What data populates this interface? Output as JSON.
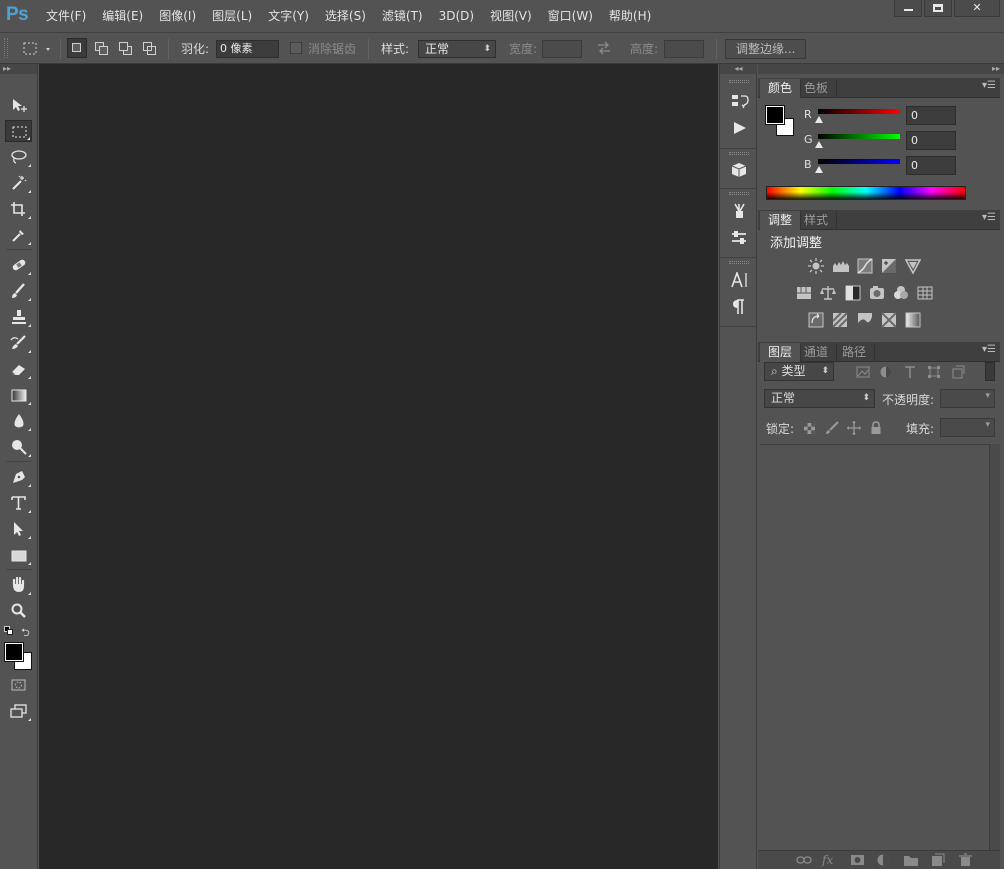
{
  "app": {
    "logo": "Ps",
    "menus": [
      "文件(F)",
      "编辑(E)",
      "图像(I)",
      "图层(L)",
      "文字(Y)",
      "选择(S)",
      "滤镜(T)",
      "3D(D)",
      "视图(V)",
      "窗口(W)",
      "帮助(H)"
    ],
    "window_close": "✕"
  },
  "options": {
    "feather_label": "羽化:",
    "feather_value": "0 像素",
    "antialias_label": "消除锯齿",
    "style_label": "样式:",
    "style_value": "正常",
    "width_label": "宽度:",
    "height_label": "高度:",
    "refine_edge_label": "调整边缘...",
    "collapse_arrows": "◂◂"
  },
  "panels": {
    "color_tabs": [
      "颜色",
      "色板"
    ],
    "rgb": {
      "r_label": "R",
      "g_label": "G",
      "b_label": "B",
      "r_value": "0",
      "g_value": "0",
      "b_value": "0"
    },
    "adjust_tabs": [
      "调整",
      "样式"
    ],
    "adjust_title": "添加调整",
    "layers_tabs": [
      "图层",
      "通道",
      "路径"
    ],
    "layer_filter": "类型",
    "blend_mode": "正常",
    "opacity_label": "不透明度:",
    "lock_label": "锁定:",
    "fill_label": "填充:"
  },
  "colors": {
    "foreground": "#000000",
    "background": "#ffffff",
    "canvas": "#282828",
    "chrome": "#535353"
  }
}
